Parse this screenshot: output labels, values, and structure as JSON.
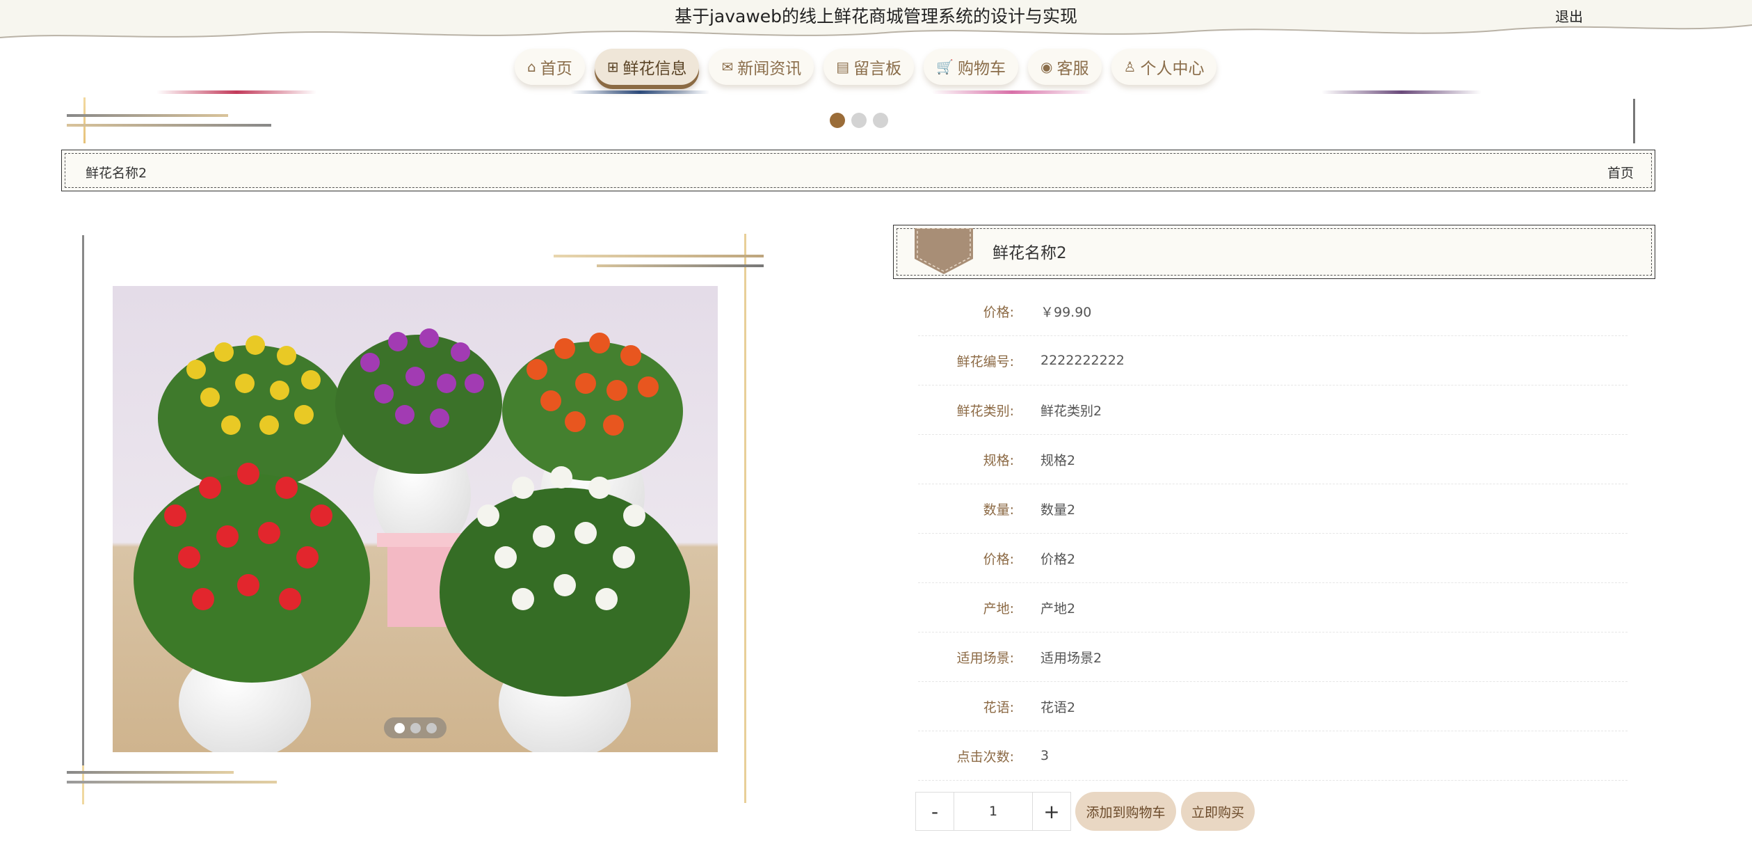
{
  "header": {
    "title": "基于javaweb的线上鲜花商城管理系统的设计与实现",
    "logout": "退出"
  },
  "nav": [
    {
      "label": "首页",
      "icon": "home-icon",
      "glyph": "⌂"
    },
    {
      "label": "鲜花信息",
      "icon": "gift-icon",
      "glyph": "⊞"
    },
    {
      "label": "新闻资讯",
      "icon": "mail-icon",
      "glyph": "✉"
    },
    {
      "label": "留言板",
      "icon": "note-icon",
      "glyph": "▤"
    },
    {
      "label": "购物车",
      "icon": "cart-icon",
      "glyph": "🛒"
    },
    {
      "label": "客服",
      "icon": "chat-icon",
      "glyph": "◉"
    },
    {
      "label": "个人中心",
      "icon": "user-icon",
      "glyph": "♙"
    }
  ],
  "active_nav": 1,
  "breadcrumb": {
    "current": "鲜花名称2",
    "home": "首页"
  },
  "detail": {
    "title": "鲜花名称2",
    "rows": [
      {
        "label": "价格:",
        "value": "￥99.90"
      },
      {
        "label": "鲜花编号:",
        "value": "2222222222"
      },
      {
        "label": "鲜花类别:",
        "value": "鲜花类别2"
      },
      {
        "label": "规格:",
        "value": "规格2"
      },
      {
        "label": "数量:",
        "value": "数量2"
      },
      {
        "label": "价格:",
        "value": "价格2"
      },
      {
        "label": "产地:",
        "value": "产地2"
      },
      {
        "label": "适用场景:",
        "value": "适用场景2"
      },
      {
        "label": "花语:",
        "value": "花语2"
      },
      {
        "label": "点击次数:",
        "value": "3"
      }
    ]
  },
  "actions": {
    "minus": "-",
    "plus": "+",
    "quantity": "1",
    "add_to_cart": "添加到购物车",
    "buy_now": "立即购买"
  },
  "colors": {
    "accent": "#9a6c38",
    "nav_text": "#8a6d4a",
    "button_bg": "#e9d7c3",
    "label_text": "#8c6a45",
    "panel_bg": "#fbfaf5"
  }
}
